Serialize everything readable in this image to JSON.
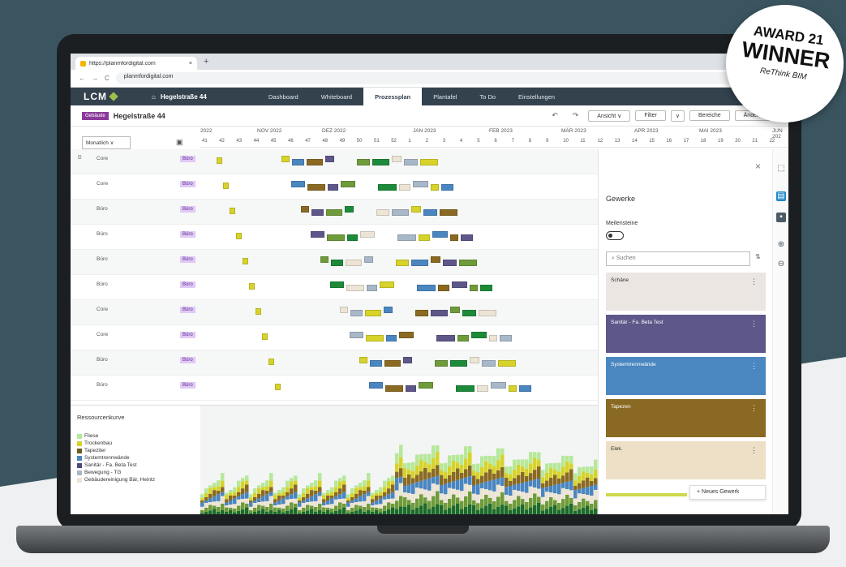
{
  "award": {
    "line1": "AWARD 21",
    "line2": "WINNER",
    "line3": "ReThink BIM"
  },
  "browser": {
    "tab_title": "https://planmfordigital.com",
    "new_tab": "+",
    "url": "planmfordigital.com",
    "nav_back": "←",
    "nav_forward": "→",
    "nav_reload": "C"
  },
  "app": {
    "logo": "LCM",
    "project_name": "Hegelstraße 44",
    "nav": [
      {
        "label": "Dashboard",
        "active": false
      },
      {
        "label": "Whiteboard",
        "active": false
      },
      {
        "label": "Prozessplan",
        "active": true
      },
      {
        "label": "Plantafel",
        "active": false
      },
      {
        "label": "To Do",
        "active": false
      },
      {
        "label": "Einstellungen",
        "active": false
      }
    ]
  },
  "toolbar": {
    "badge": "Gebäude",
    "title": "Hegelstraße 44",
    "undo": "↶",
    "redo": "↷",
    "ansicht": "Ansicht ∨",
    "filter": "Filter",
    "filter_caret": "∨",
    "bereiche": "Bereiche",
    "aenderung": "Änderung"
  },
  "timeline": {
    "select": "Monatlich ∨",
    "cal_icon": "calendar-icon",
    "months": [
      "2022",
      "NOV 2022",
      "DEZ 2022",
      "JAN 2023",
      "FEB 2023",
      "MÄR 2023",
      "APR 2023",
      "MAI 2023",
      "JUN 202"
    ],
    "weeks": [
      "41",
      "42",
      "43",
      "44",
      "45",
      "46",
      "47",
      "48",
      "49",
      "50",
      "51",
      "52",
      "1",
      "2",
      "3",
      "4",
      "5",
      "6",
      "7",
      "8",
      "9",
      "10",
      "11",
      "12",
      "13",
      "14",
      "15",
      "16",
      "17",
      "18",
      "19",
      "20",
      "21",
      "22"
    ]
  },
  "rows": [
    {
      "label": "Core",
      "tag": "Büro"
    },
    {
      "label": "Core",
      "tag": "Büro"
    },
    {
      "label": "Büro",
      "tag": "Büro"
    },
    {
      "label": "Büro",
      "tag": "Büro"
    },
    {
      "label": "Büro",
      "tag": "Büro"
    },
    {
      "label": "Büro",
      "tag": "Büro"
    },
    {
      "label": "Core",
      "tag": "Büro"
    },
    {
      "label": "Core",
      "tag": "Büro"
    },
    {
      "label": "Büro",
      "tag": "Büro"
    },
    {
      "label": "Büro",
      "tag": "Büro"
    }
  ],
  "resource": {
    "title": "Ressourcenkurve",
    "legend": [
      {
        "label": "Fliese",
        "color": "#b7e89a"
      },
      {
        "label": "Trockenbau",
        "color": "#d7d32a"
      },
      {
        "label": "Tapeziter",
        "color": "#6b5a1e"
      },
      {
        "label": "Systemtrennwände",
        "color": "#4a86c0"
      },
      {
        "label": "Sanitär - Fa. Beta Test",
        "color": "#4f4a7a"
      },
      {
        "label": "Bewegung - TG",
        "color": "#a8b8c8"
      },
      {
        "label": "Gebäudereinigung Bär, Heintz",
        "color": "#ece4d4"
      }
    ]
  },
  "panel": {
    "close": "×",
    "title": "Gewerke",
    "milestones": "Meilensteine",
    "search_placeholder": "Suchen",
    "sort": "⇅",
    "cards": [
      {
        "label": "Schäne",
        "color": "#ece6e3",
        "text_color": "#333"
      },
      {
        "label": "Sanitär - Fa. Beta Test",
        "color": "#5e5789",
        "text_color": "#fff"
      },
      {
        "label": "Systemtrennwände",
        "color": "#4a86c0",
        "text_color": "#fff"
      },
      {
        "label": "Tapezen",
        "color": "#8a6a22",
        "text_color": "#fff"
      },
      {
        "label": "Elek.",
        "color": "#eee0c6",
        "text_color": "#333"
      }
    ],
    "new_button": "+ Neues Gewerk"
  },
  "sidebar_icons": [
    "select-icon",
    "panel-icon",
    "settings-icon",
    "zoom-in-icon",
    "zoom-out-icon"
  ]
}
